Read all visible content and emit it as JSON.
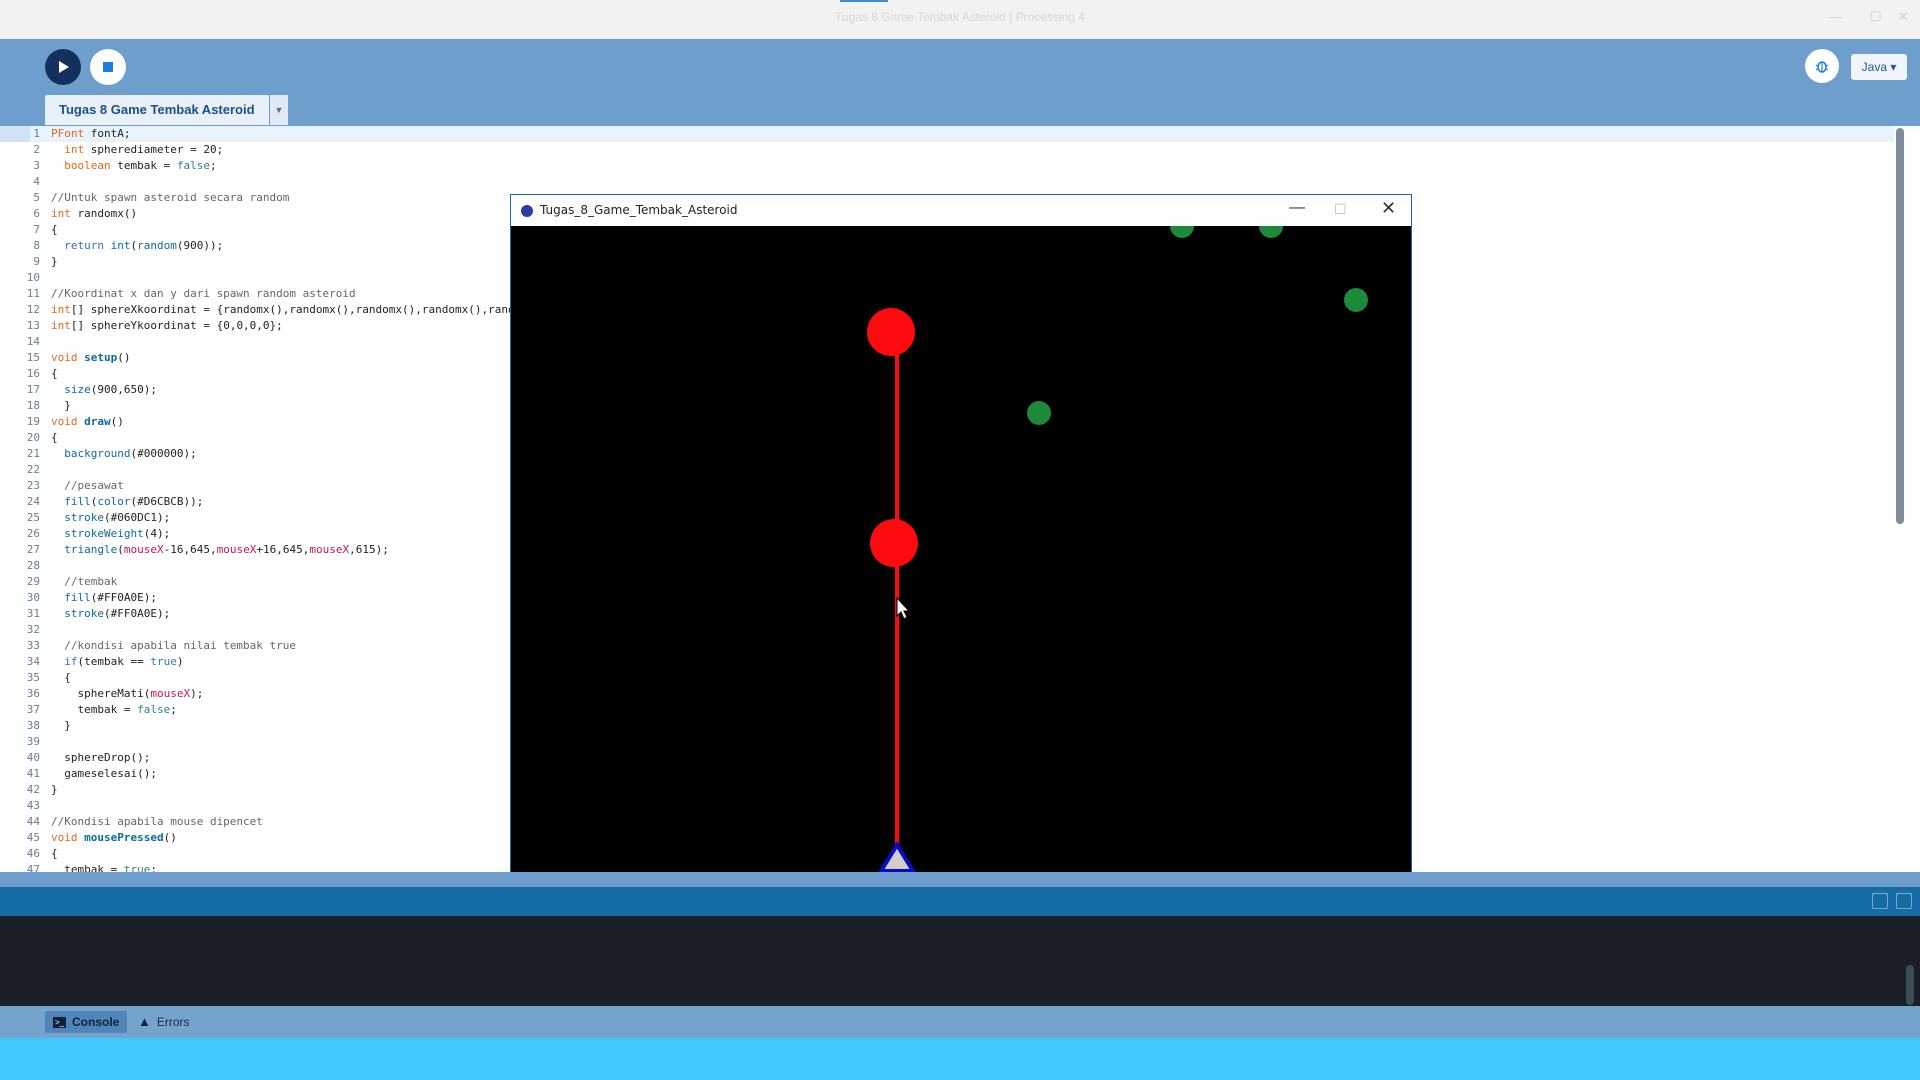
{
  "window": {
    "title": "Tugas 8 Game Tembak Asteroid | Processing 4",
    "accent": "#3b8fd8"
  },
  "toolbar": {
    "run_icon": "play-icon",
    "stop_icon": "stop-icon",
    "debug_icon": "debugger-icon",
    "mode_label": "Java ▾"
  },
  "tabs": [
    {
      "label": "Tugas 8 Game Tembak Asteroid"
    }
  ],
  "editor": {
    "lines": [
      {
        "n": "1",
        "html": "<span class=\"kt\">PFont</span> fontA;"
      },
      {
        "n": "2",
        "html": "  <span class=\"kt\">int</span> spherediameter = 20;"
      },
      {
        "n": "3",
        "html": "  <span class=\"kt\">boolean</span> tembak = <span class=\"lit\">false</span>;"
      },
      {
        "n": "4",
        "html": ""
      },
      {
        "n": "5",
        "html": "<span class=\"cm\">//Untuk spawn asteroid secara random</span>"
      },
      {
        "n": "6",
        "html": "<span class=\"kt\">int</span> randomx()"
      },
      {
        "n": "7",
        "html": "{"
      },
      {
        "n": "8",
        "html": "  <span class=\"kw\">return</span> <span class=\"fn\">int</span>(<span class=\"fn\">random</span>(900));"
      },
      {
        "n": "9",
        "html": "}"
      },
      {
        "n": "10",
        "html": ""
      },
      {
        "n": "11",
        "html": "<span class=\"cm\">//Koordinat x dan y dari spawn random asteroid</span>"
      },
      {
        "n": "12",
        "html": "<span class=\"kt\">int</span>[] sphereXkoordinat = {randomx(),randomx(),randomx(),randomx(),randomx()};"
      },
      {
        "n": "13",
        "html": "<span class=\"kt\">int</span>[] sphereYkoordinat = {0,0,0,0};"
      },
      {
        "n": "14",
        "html": ""
      },
      {
        "n": "15",
        "html": "<span class=\"kt\">void</span> <span class=\"fnb\">setup</span>()"
      },
      {
        "n": "16",
        "html": "{"
      },
      {
        "n": "17",
        "html": "  <span class=\"fn\">size</span>(900,650);"
      },
      {
        "n": "18",
        "html": "  }"
      },
      {
        "n": "19",
        "html": "<span class=\"kt\">void</span> <span class=\"fnb\">draw</span>()"
      },
      {
        "n": "20",
        "html": "{"
      },
      {
        "n": "21",
        "html": "  <span class=\"fn\">background</span>(#000000);"
      },
      {
        "n": "22",
        "html": ""
      },
      {
        "n": "23",
        "html": "  <span class=\"cm\">//pesawat</span>"
      },
      {
        "n": "24",
        "html": "  <span class=\"fn\">fill</span>(<span class=\"fn\">color</span>(#D6CBCB));"
      },
      {
        "n": "25",
        "html": "  <span class=\"fn\">stroke</span>(#060DC1);"
      },
      {
        "n": "26",
        "html": "  <span class=\"fn\">strokeWeight</span>(4);"
      },
      {
        "n": "27",
        "html": "  <span class=\"fn\">triangle</span>(<span class=\"var\">mouseX</span>-16,645,<span class=\"var\">mouseX</span>+16,645,<span class=\"var\">mouseX</span>,615);"
      },
      {
        "n": "28",
        "html": ""
      },
      {
        "n": "29",
        "html": "  <span class=\"cm\">//tembak</span>"
      },
      {
        "n": "30",
        "html": "  <span class=\"fn\">fill</span>(#FF0A0E);"
      },
      {
        "n": "31",
        "html": "  <span class=\"fn\">stroke</span>(#FF0A0E);"
      },
      {
        "n": "32",
        "html": ""
      },
      {
        "n": "33",
        "html": "  <span class=\"cm\">//kondisi apabila nilai tembak true</span>"
      },
      {
        "n": "34",
        "html": "  <span class=\"kw\">if</span>(tembak == <span class=\"lit\">true</span>)"
      },
      {
        "n": "35",
        "html": "  {"
      },
      {
        "n": "36",
        "html": "    sphereMati(<span class=\"var\">mouseX</span>);"
      },
      {
        "n": "37",
        "html": "    tembak = <span class=\"lit\">false</span>;"
      },
      {
        "n": "38",
        "html": "  }"
      },
      {
        "n": "39",
        "html": ""
      },
      {
        "n": "40",
        "html": "  sphereDrop();"
      },
      {
        "n": "41",
        "html": "  gameselesai();"
      },
      {
        "n": "42",
        "html": "}"
      },
      {
        "n": "43",
        "html": ""
      },
      {
        "n": "44",
        "html": "<span class=\"cm\">//Kondisi apabila mouse dipencet</span>"
      },
      {
        "n": "45",
        "html": "<span class=\"kt\">void</span> <span class=\"fnb\">mousePressed</span>()"
      },
      {
        "n": "46",
        "html": "{"
      },
      {
        "n": "47",
        "html": "  tembak = <span class=\"lit\">true</span>;"
      }
    ]
  },
  "sketch_window": {
    "title": "Tugas_8_Game_Tembak_Asteroid",
    "min_icon": "minimize-icon",
    "max_icon": "maximize-icon",
    "close_icon": "close-icon",
    "canvas": {
      "background": "#000000",
      "ship": {
        "fill": "#D6CBCB",
        "stroke": "#060DC1"
      },
      "laser_color": "#FF0A0E",
      "asteroid_color": "#1d8a3a"
    }
  },
  "console": {
    "tabs": [
      {
        "label": "Console",
        "icon": "console-icon"
      },
      {
        "label": "Errors",
        "icon": "warning-icon"
      }
    ]
  }
}
